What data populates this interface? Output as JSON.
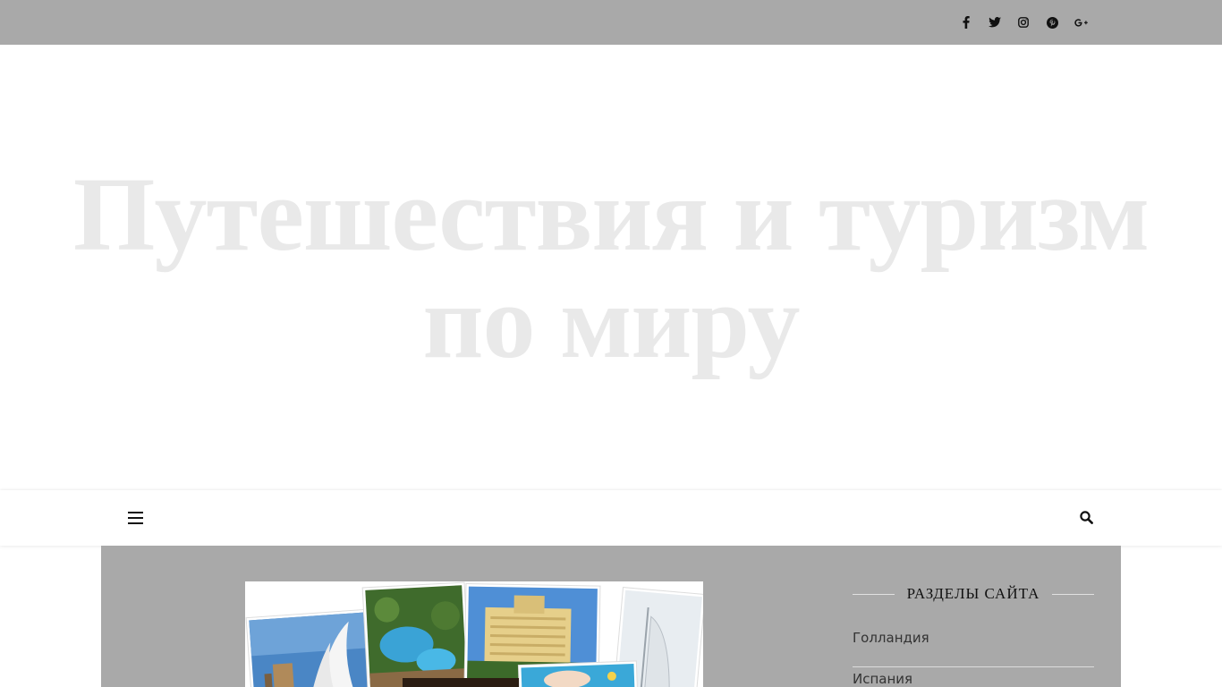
{
  "header": {
    "title_line1": "Путешествия и туризм",
    "title_line2": "по миру"
  },
  "social": {
    "icons": [
      "facebook-icon",
      "twitter-icon",
      "instagram-icon",
      "pinterest-icon",
      "google-plus-icon"
    ]
  },
  "nav": {
    "menu_icon": "hamburger-menu-icon",
    "search_icon": "search-icon"
  },
  "sidebar": {
    "widget_title": "РАЗДЕЛЫ САЙТА",
    "categories": [
      "Голландия",
      "Испания"
    ]
  },
  "colors": {
    "topbar_bg": "#a9a9a9",
    "title_color": "#e9e9e9",
    "content_bg": "#a9a9a9"
  }
}
